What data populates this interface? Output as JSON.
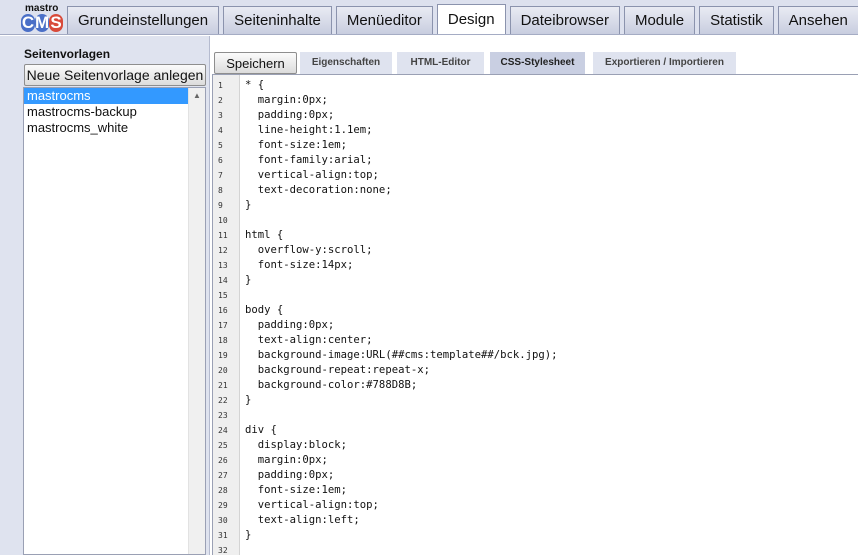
{
  "logo": {
    "top_text": "mastro",
    "letters": [
      "C",
      "M",
      "S"
    ],
    "colors": [
      "#4a6fc7",
      "#4a6fc7",
      "#d84a3a"
    ]
  },
  "tabs": [
    {
      "label": "Grundeinstellungen",
      "active": false
    },
    {
      "label": "Seiteninhalte",
      "active": false
    },
    {
      "label": "Menüeditor",
      "active": false
    },
    {
      "label": "Design",
      "active": true
    },
    {
      "label": "Dateibrowser",
      "active": false
    },
    {
      "label": "Module",
      "active": false
    },
    {
      "label": "Statistik",
      "active": false
    },
    {
      "label": "Ansehen",
      "active": false
    }
  ],
  "sidebar": {
    "title": "Seitenvorlagen",
    "new_button": "Neue Seitenvorlage anlegen",
    "items": [
      {
        "label": "mastrocms",
        "selected": true
      },
      {
        "label": "mastrocms-backup",
        "selected": false
      },
      {
        "label": "mastrocms_white",
        "selected": false
      }
    ],
    "scroll_up_icon": "▲"
  },
  "toolbar": {
    "save_label": "Speichern",
    "subtabs": [
      {
        "label": "Eigenschaften",
        "active": false
      },
      {
        "label": "HTML-Editor",
        "active": false
      },
      {
        "label": "CSS-Stylesheet",
        "active": true
      },
      {
        "label": "Exportieren / Importieren",
        "active": false
      }
    ]
  },
  "editor": {
    "lines": [
      "* {",
      "  margin:0px;",
      "  padding:0px;",
      "  line-height:1.1em;",
      "  font-size:1em;",
      "  font-family:arial;",
      "  vertical-align:top;",
      "  text-decoration:none;",
      "}",
      "",
      "html {",
      "  overflow-y:scroll;",
      "  font-size:14px;",
      "}",
      "",
      "body {",
      "  padding:0px;",
      "  text-align:center;",
      "  background-image:URL(##cms:template##/bck.jpg);",
      "  background-repeat:repeat-x;",
      "  background-color:#788D8B;",
      "}",
      "",
      "div {",
      "  display:block;",
      "  margin:0px;",
      "  padding:0px;",
      "  font-size:1em;",
      "  vertical-align:top;",
      "  text-align:left;",
      "}",
      ""
    ]
  }
}
